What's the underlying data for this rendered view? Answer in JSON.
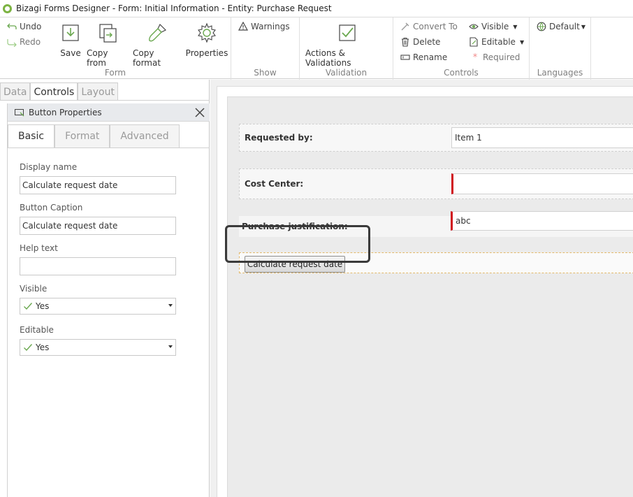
{
  "window": {
    "title": "Bizagi Forms Designer  - Form: Initial Information - Entity:  Purchase Request"
  },
  "ribbon": {
    "form": {
      "undo": "Undo",
      "redo": "Redo",
      "save": "Save",
      "copy_from": "Copy from",
      "copy_format": "Copy format",
      "properties": "Properties",
      "label": "Form"
    },
    "show": {
      "warnings": "Warnings",
      "label": "Show"
    },
    "validation": {
      "actions": "Actions & Validations",
      "label": "Validation"
    },
    "controls": {
      "convert_to": "Convert To",
      "delete": "Delete",
      "rename": "Rename",
      "visible": "Visible",
      "editable": "Editable",
      "required": "Required",
      "label": "Controls"
    },
    "languages": {
      "default": "Default",
      "label": "Languages"
    }
  },
  "left_tabs": [
    "Data",
    "Controls",
    "Layout"
  ],
  "properties_panel": {
    "title": "Button Properties",
    "tabs": [
      "Basic",
      "Format",
      "Advanced"
    ],
    "display_name_label": "Display name",
    "display_name_value": "Calculate request date",
    "button_caption_label": "Button Caption",
    "button_caption_value": "Calculate request date",
    "help_text_label": "Help text",
    "help_text_value": "",
    "visible_label": "Visible",
    "visible_value": "Yes",
    "editable_label": "Editable",
    "editable_value": "Yes"
  },
  "form": {
    "requested_by_label": "Requested by:",
    "requested_by_value": "Item 1",
    "cost_center_label": "Cost Center:",
    "cost_center_value": "",
    "justification_label": "Purchase justification:",
    "justification_value": "abc",
    "button_caption": "Calculate request date"
  },
  "colors": {
    "accent_green": "#7cb342",
    "required_red": "#d0111b",
    "highlight": "#3a3a3a"
  }
}
